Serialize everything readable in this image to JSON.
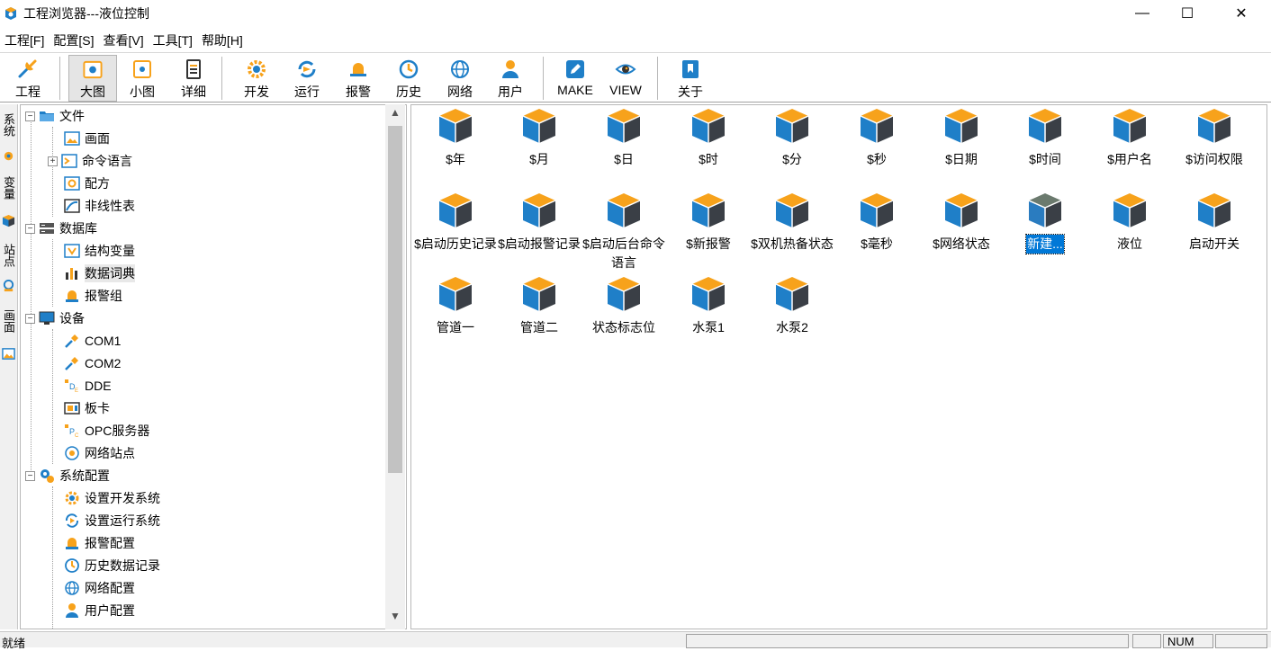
{
  "window": {
    "title": "工程浏览器---液位控制",
    "minimize": "—",
    "maximize": "☐",
    "close": "✕"
  },
  "menu": [
    "工程[F]",
    "配置[S]",
    "查看[V]",
    "工具[T]",
    "帮助[H]"
  ],
  "toolbar": {
    "project": "工程",
    "large": "大图",
    "small": "小图",
    "detail": "详细",
    "develop": "开发",
    "run": "运行",
    "alarm": "报警",
    "history": "历史",
    "network": "网络",
    "user": "用户",
    "make": "MAKE",
    "view": "VIEW",
    "about": "关于"
  },
  "vtabs": [
    "系统",
    "变量",
    "站点",
    "画面"
  ],
  "tree": {
    "file": "文件",
    "screen": "画面",
    "cmd_lang": "命令语言",
    "recipe": "配方",
    "nonlinear": "非线性表",
    "database": "数据库",
    "struct_var": "结构变量",
    "data_dict": "数据词典",
    "alarm_group": "报警组",
    "device": "设备",
    "com1": "COM1",
    "com2": "COM2",
    "dde": "DDE",
    "board": "板卡",
    "opc": "OPC服务器",
    "net_station": "网络站点",
    "sys_config": "系统配置",
    "set_dev": "设置开发系统",
    "set_run": "设置运行系统",
    "alarm_cfg": "报警配置",
    "hist_cfg": "历史数据记录",
    "net_cfg": "网络配置",
    "user_cfg": "用户配置"
  },
  "grid_items": [
    "$年",
    "$月",
    "$日",
    "$时",
    "$分",
    "$秒",
    "$日期",
    "$时间",
    "$用户名",
    "$访问权限",
    "$启动历史记录",
    "$启动报警记录",
    "$启动后台命令语言",
    "$新报警",
    "$双机热备状态",
    "$毫秒",
    "$网络状态",
    "新建...",
    "液位",
    "启动开关",
    "管道一",
    "管道二",
    "状态标志位",
    "水泵1",
    "水泵2"
  ],
  "status": {
    "text": "就绪",
    "num": "NUM"
  },
  "colors": {
    "cube_top": "#f7a21b",
    "cube_left": "#1f7fc8",
    "cube_right": "#3a3f46",
    "selection": "#0078d7"
  }
}
